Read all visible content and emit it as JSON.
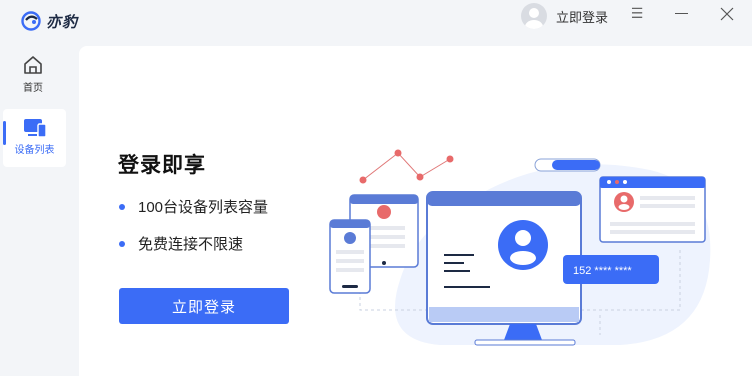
{
  "app": {
    "name": "亦豹"
  },
  "titlebar": {
    "login_label": "立即登录",
    "menu_glyph": "☰"
  },
  "sidebar": {
    "items": [
      {
        "label": "首页",
        "active": false
      },
      {
        "label": "设备列表",
        "active": true
      }
    ]
  },
  "main": {
    "headline": "登录即享",
    "features": [
      "100台设备列表容量",
      "免费连接不限速"
    ],
    "cta_label": "立即登录",
    "illustration": {
      "card_number": "152 **** ****"
    }
  },
  "colors": {
    "accent": "#3b6cf6",
    "background": "#f3f5f8",
    "card": "#ffffff"
  }
}
